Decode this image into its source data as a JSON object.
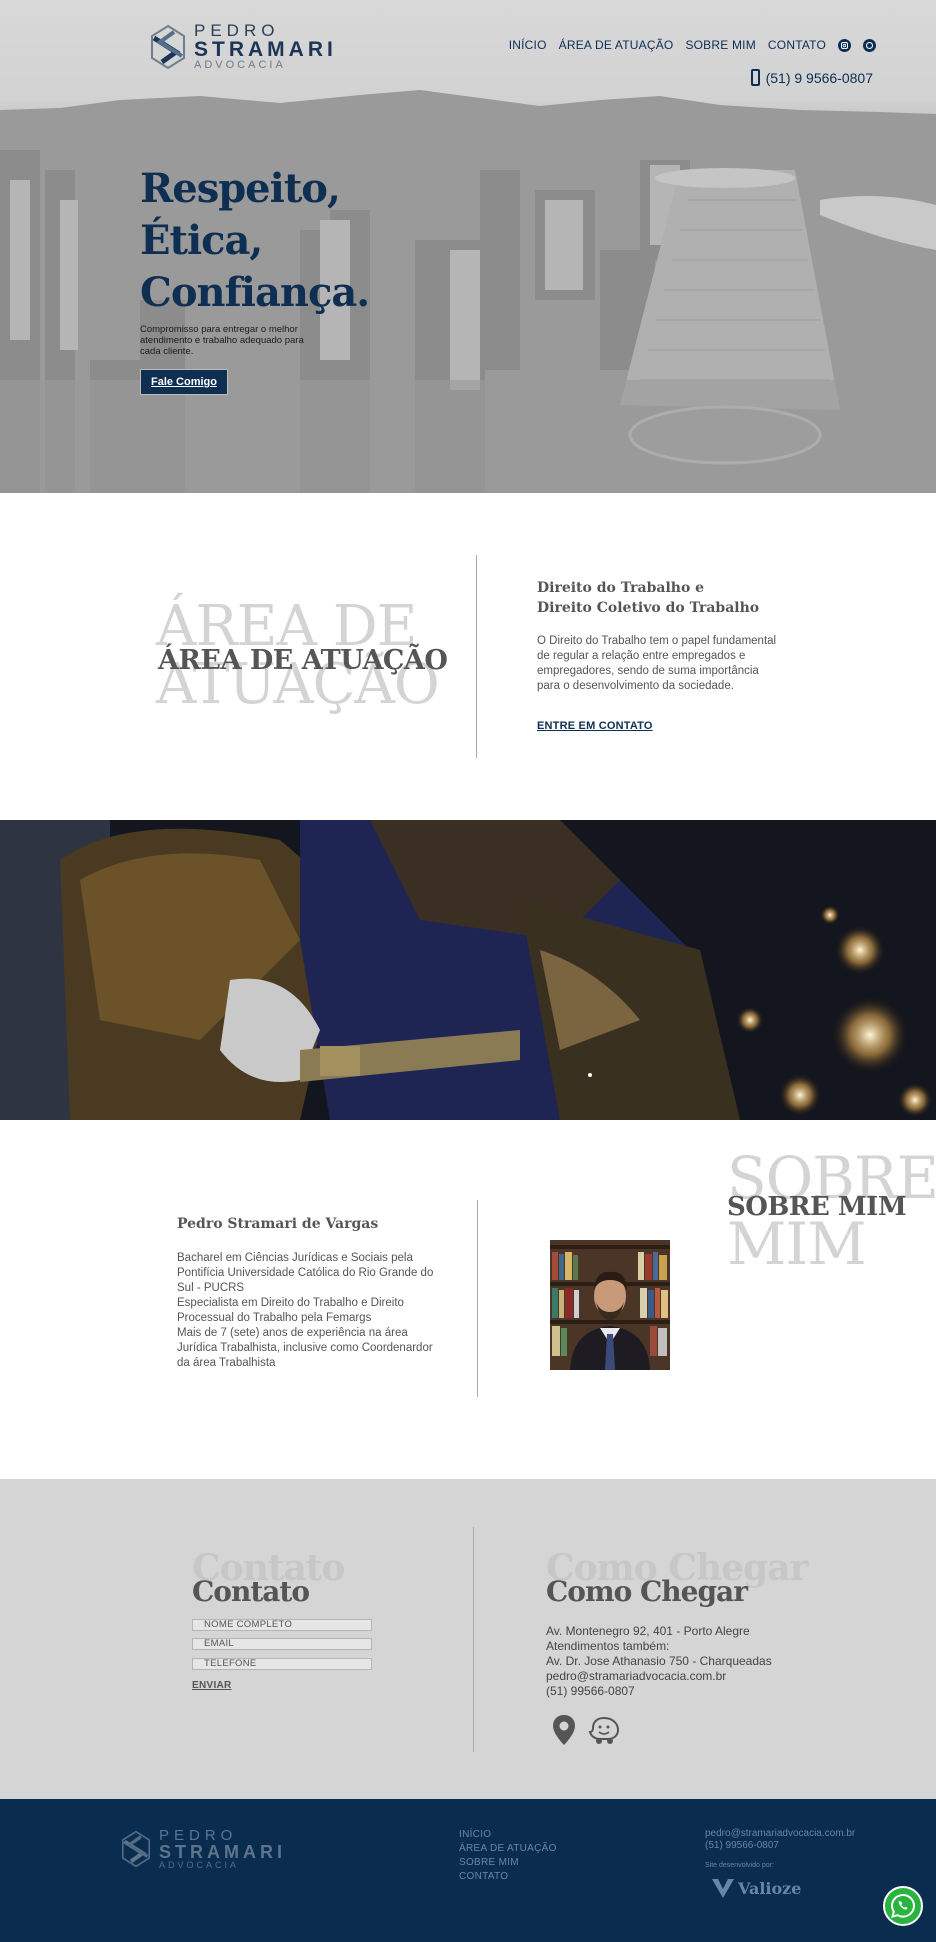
{
  "brand": {
    "line1": "PEDRO",
    "line2": "STRAMARI",
    "line3": "ADVOCACIA"
  },
  "nav": {
    "items": [
      {
        "label": "INÍCIO"
      },
      {
        "label": "ÁREA DE ATUAÇÃO"
      },
      {
        "label": "SOBRE MIM"
      },
      {
        "label": "CONTATO"
      }
    ],
    "icons": [
      "instagram-icon",
      "whatsapp-icon"
    ],
    "phone": "(51) 9 9566-0807"
  },
  "hero": {
    "heading_lines": [
      "Respeito,",
      "Ética,",
      "Confiança."
    ],
    "subtitle": "Compromisso para entregar o melhor atendimento e trabalho adequado para cada cliente.",
    "cta": "Fale Comigo"
  },
  "area": {
    "ghost_lines": [
      "ÁREA DE",
      "ATUAÇÃO"
    ],
    "title": "ÁREA DE ATUAÇÃO",
    "heading_lines": [
      "Direito do Trabalho e",
      "Direito Coletivo do Trabalho"
    ],
    "text": "O Direito do Trabalho tem o papel fundamental de regular a relação entre empregados e empregadores, sendo de suma importância para o desenvolvimento da sociedade.",
    "link": "ENTRE EM CONTATO"
  },
  "about": {
    "ghost_lines": [
      "SOBRE",
      "MIM"
    ],
    "title": "SOBRE MIM",
    "name": "Pedro Stramari de Vargas",
    "text_lines": [
      "Bacharel em Ciências Jurídicas e Sociais pela Pontifícia Universidade Católica do Rio Grande do Sul - PUCRS",
      "Especialista em Direito do Trabalho e Direito Processual do Trabalho pela Femargs",
      "Mais de 7 (sete) anos de experiência na área Jurídica Trabalhista, inclusive como Coordenardor da área Trabalhista"
    ]
  },
  "contact": {
    "ghost": "Contato",
    "title": "Contato",
    "fields": [
      {
        "placeholder": "NOME COMPLETO"
      },
      {
        "placeholder": "EMAIL"
      },
      {
        "placeholder": "TELEFONE"
      }
    ],
    "submit": "ENVIAR"
  },
  "directions": {
    "ghost": "Como Chegar",
    "title": "Como Chegar",
    "lines": [
      "Av. Montenegro 92, 401 - Porto Alegre",
      "Atendimentos também:",
      "Av. Dr. Jose Athanasio 750 - Charqueadas",
      "pedro@stramariadvocacia.com.br",
      "(51) 99566-0807"
    ],
    "icons": [
      "map-pin-icon",
      "waze-icon"
    ]
  },
  "footer": {
    "links": [
      "INÍCIO",
      "ÁREA DE ATUAÇÃO",
      "SOBRE MIM",
      "CONTATO"
    ],
    "email": "pedro@stramariadvocacia.com.br",
    "phone": "(51) 99566-0807",
    "dev_label": "Site desenvolvido por:",
    "dev_name": "Valioze"
  },
  "colors": {
    "navy": "#0e2e52",
    "footer": "#0a2c4f",
    "ghost": "#d4d4d4",
    "whatsapp": "#29b43f"
  }
}
